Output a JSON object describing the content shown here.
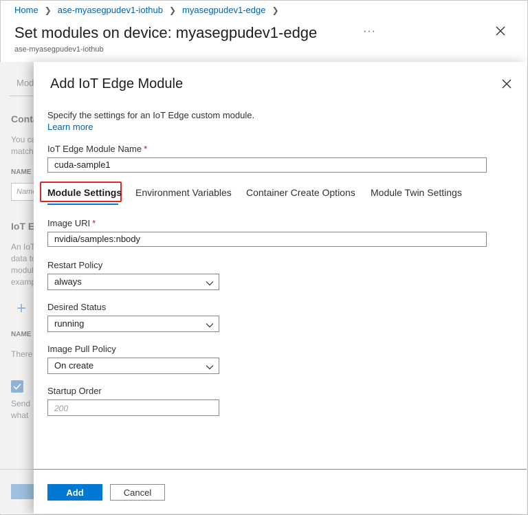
{
  "breadcrumb": {
    "items": [
      "Home",
      "ase-myasegpudev1-iothub",
      "myasegpudev1-edge"
    ]
  },
  "blade": {
    "title": "Set modules on device: myasegpudev1-edge",
    "subtitle": "ase-myasegpudev1-iothub",
    "more": "···"
  },
  "background": {
    "tab": "Modules",
    "section1_title": "Container Registry Credentials",
    "section1_desc_line1": "You can specify credentials to container registries hosting module images. Listed credentials are used to retrieve modules with a",
    "section1_desc_line2": "matching URL.",
    "name_label": "NAME",
    "name_placeholder": "Name",
    "section2_title": "IoT Edge Modules",
    "section2_desc_line1": "An IoT Edge module is a Docker container you can deploy to IoT Edge devices. It communicates with other modules and sends",
    "section2_desc_line2": "data to IoT Edge runtime. Modules can be configured to be",
    "section2_desc_line3": "module specific",
    "section2_desc_line4": "example",
    "add_glyph": "+",
    "name_label2": "NAME",
    "empty_text": "There are no modules",
    "send_line1": "Send",
    "send_line2": "what"
  },
  "panel": {
    "title": "Add IoT Edge Module",
    "description": "Specify the settings for an IoT Edge custom module.",
    "learn_more": "Learn more",
    "module_name_label": "IoT Edge Module Name",
    "required_mark": "*",
    "module_name_value": "cuda-sample1",
    "tabs": [
      "Module Settings",
      "Environment Variables",
      "Container Create Options",
      "Module Twin Settings"
    ],
    "image_uri_label": "Image URI",
    "image_uri_value": "nvidia/samples:nbody",
    "restart_policy_label": "Restart Policy",
    "restart_policy_value": "always",
    "desired_status_label": "Desired Status",
    "desired_status_value": "running",
    "image_pull_policy_label": "Image Pull Policy",
    "image_pull_policy_value": "On create",
    "startup_order_label": "Startup Order",
    "startup_order_placeholder": "200",
    "add_button": "Add",
    "cancel_button": "Cancel"
  },
  "colors": {
    "accent": "#0078d4",
    "link": "#0063b1",
    "highlight": "#e0252b",
    "required": "#a4262c"
  }
}
